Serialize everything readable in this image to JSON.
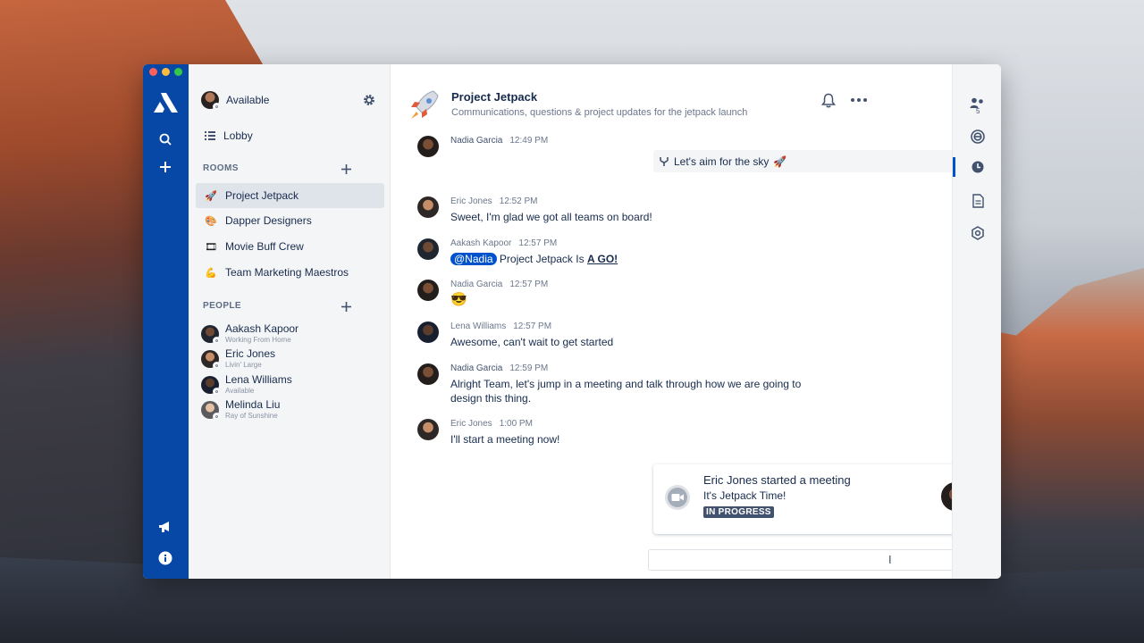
{
  "sidebar": {
    "status_label": "Available",
    "lobby_label": "Lobby",
    "rooms_heading": "ROOMS",
    "rooms": [
      {
        "label": "Project Jetpack",
        "icon": "rocket-icon"
      },
      {
        "label": "Dapper Designers",
        "icon": "palette-icon"
      },
      {
        "label": "Movie Buff Crew",
        "icon": "film-icon"
      },
      {
        "label": "Team Marketing Maestros",
        "icon": "flexed-arm-icon"
      }
    ],
    "people_heading": "PEOPLE",
    "people": [
      {
        "name": "Aakash Kapoor",
        "status": "Working From Home"
      },
      {
        "name": "Eric Jones",
        "status": "Livin' Large"
      },
      {
        "name": "Lena Williams",
        "status": "Available"
      },
      {
        "name": "Melinda Liu",
        "status": "Ray of Sunshine"
      }
    ]
  },
  "room": {
    "title": "Project Jetpack",
    "topic": "Communications, questions & project updates for the jetpack launch"
  },
  "messages": [
    {
      "author": "Nadia Garcia",
      "time": "12:49 PM",
      "text": "Let's aim for the sky",
      "emoji": "🚀"
    },
    {
      "author": "Eric Jones",
      "time": "12:52 PM",
      "text": "Sweet, I'm glad we got all teams on board!"
    },
    {
      "author": "Aakash Kapoor",
      "time": "12:57 PM",
      "mention": "@Nadia",
      "text": "Project Jetpack Is",
      "bold": "A GO!"
    },
    {
      "author": "Nadia Garcia",
      "time": "12:57 PM",
      "emoji": "😎"
    },
    {
      "author": "Lena Williams",
      "time": "12:57 PM",
      "text": "Awesome, can't wait to get started"
    },
    {
      "author": "Nadia Garcia",
      "time": "12:59 PM",
      "line1": "Alright Team, let's jump in a meeting and talk through how we are going to",
      "line2": "design this thing."
    },
    {
      "author": "Eric Jones",
      "time": "1:00 PM",
      "text": "I'll start a meeting now!"
    }
  ],
  "meeting": {
    "title": "Eric Jones started a meeting",
    "subtitle": "It's Jetpack Time!",
    "badge": "IN PROGRESS"
  },
  "right_bar": {
    "member_count": "5"
  },
  "colors": {
    "nav_blue": "#0747a6",
    "accent": "#0052cc",
    "text": "#172b4d"
  }
}
